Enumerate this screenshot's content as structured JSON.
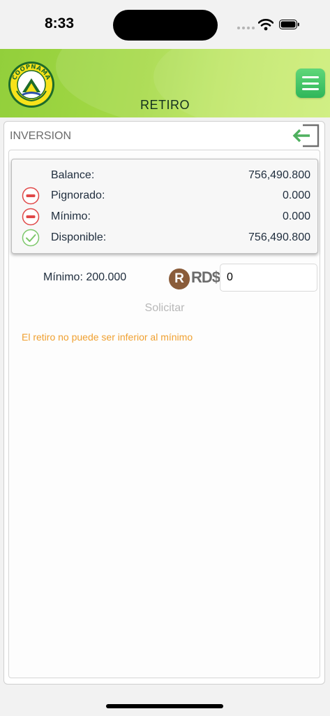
{
  "status_bar": {
    "time": "8:33"
  },
  "header": {
    "title": "RETIRO",
    "logo_text": "COOPNAMA",
    "colors": {
      "header_green": "#a6da47",
      "menu_green": "#2fb65a"
    }
  },
  "section": {
    "title": "INVERSION",
    "exit_icon": "exit-arrow-icon"
  },
  "balances": [
    {
      "label": "Balance:",
      "value": "756,490.800",
      "icon": "none"
    },
    {
      "label": "Pignorado:",
      "value": "0.000",
      "icon": "minus-circle-icon"
    },
    {
      "label": "Mínimo:",
      "value": "0.000",
      "icon": "minus-circle-icon"
    },
    {
      "label": "Disponible:",
      "value": "756,490.800",
      "icon": "check-circle-icon"
    }
  ],
  "withdraw": {
    "minimum_text": "Mínimo: 200.000",
    "currency_badge": "R",
    "currency_label": "RD$",
    "amount_value": "0",
    "submit_label": "Solicitar",
    "warning": "El retiro no puede ser inferior al mínimo"
  },
  "colors": {
    "warning": "#f0a030",
    "minus_red": "#e04848",
    "check_green": "#7cc76a",
    "currency_brown": "#8a5c3a"
  }
}
